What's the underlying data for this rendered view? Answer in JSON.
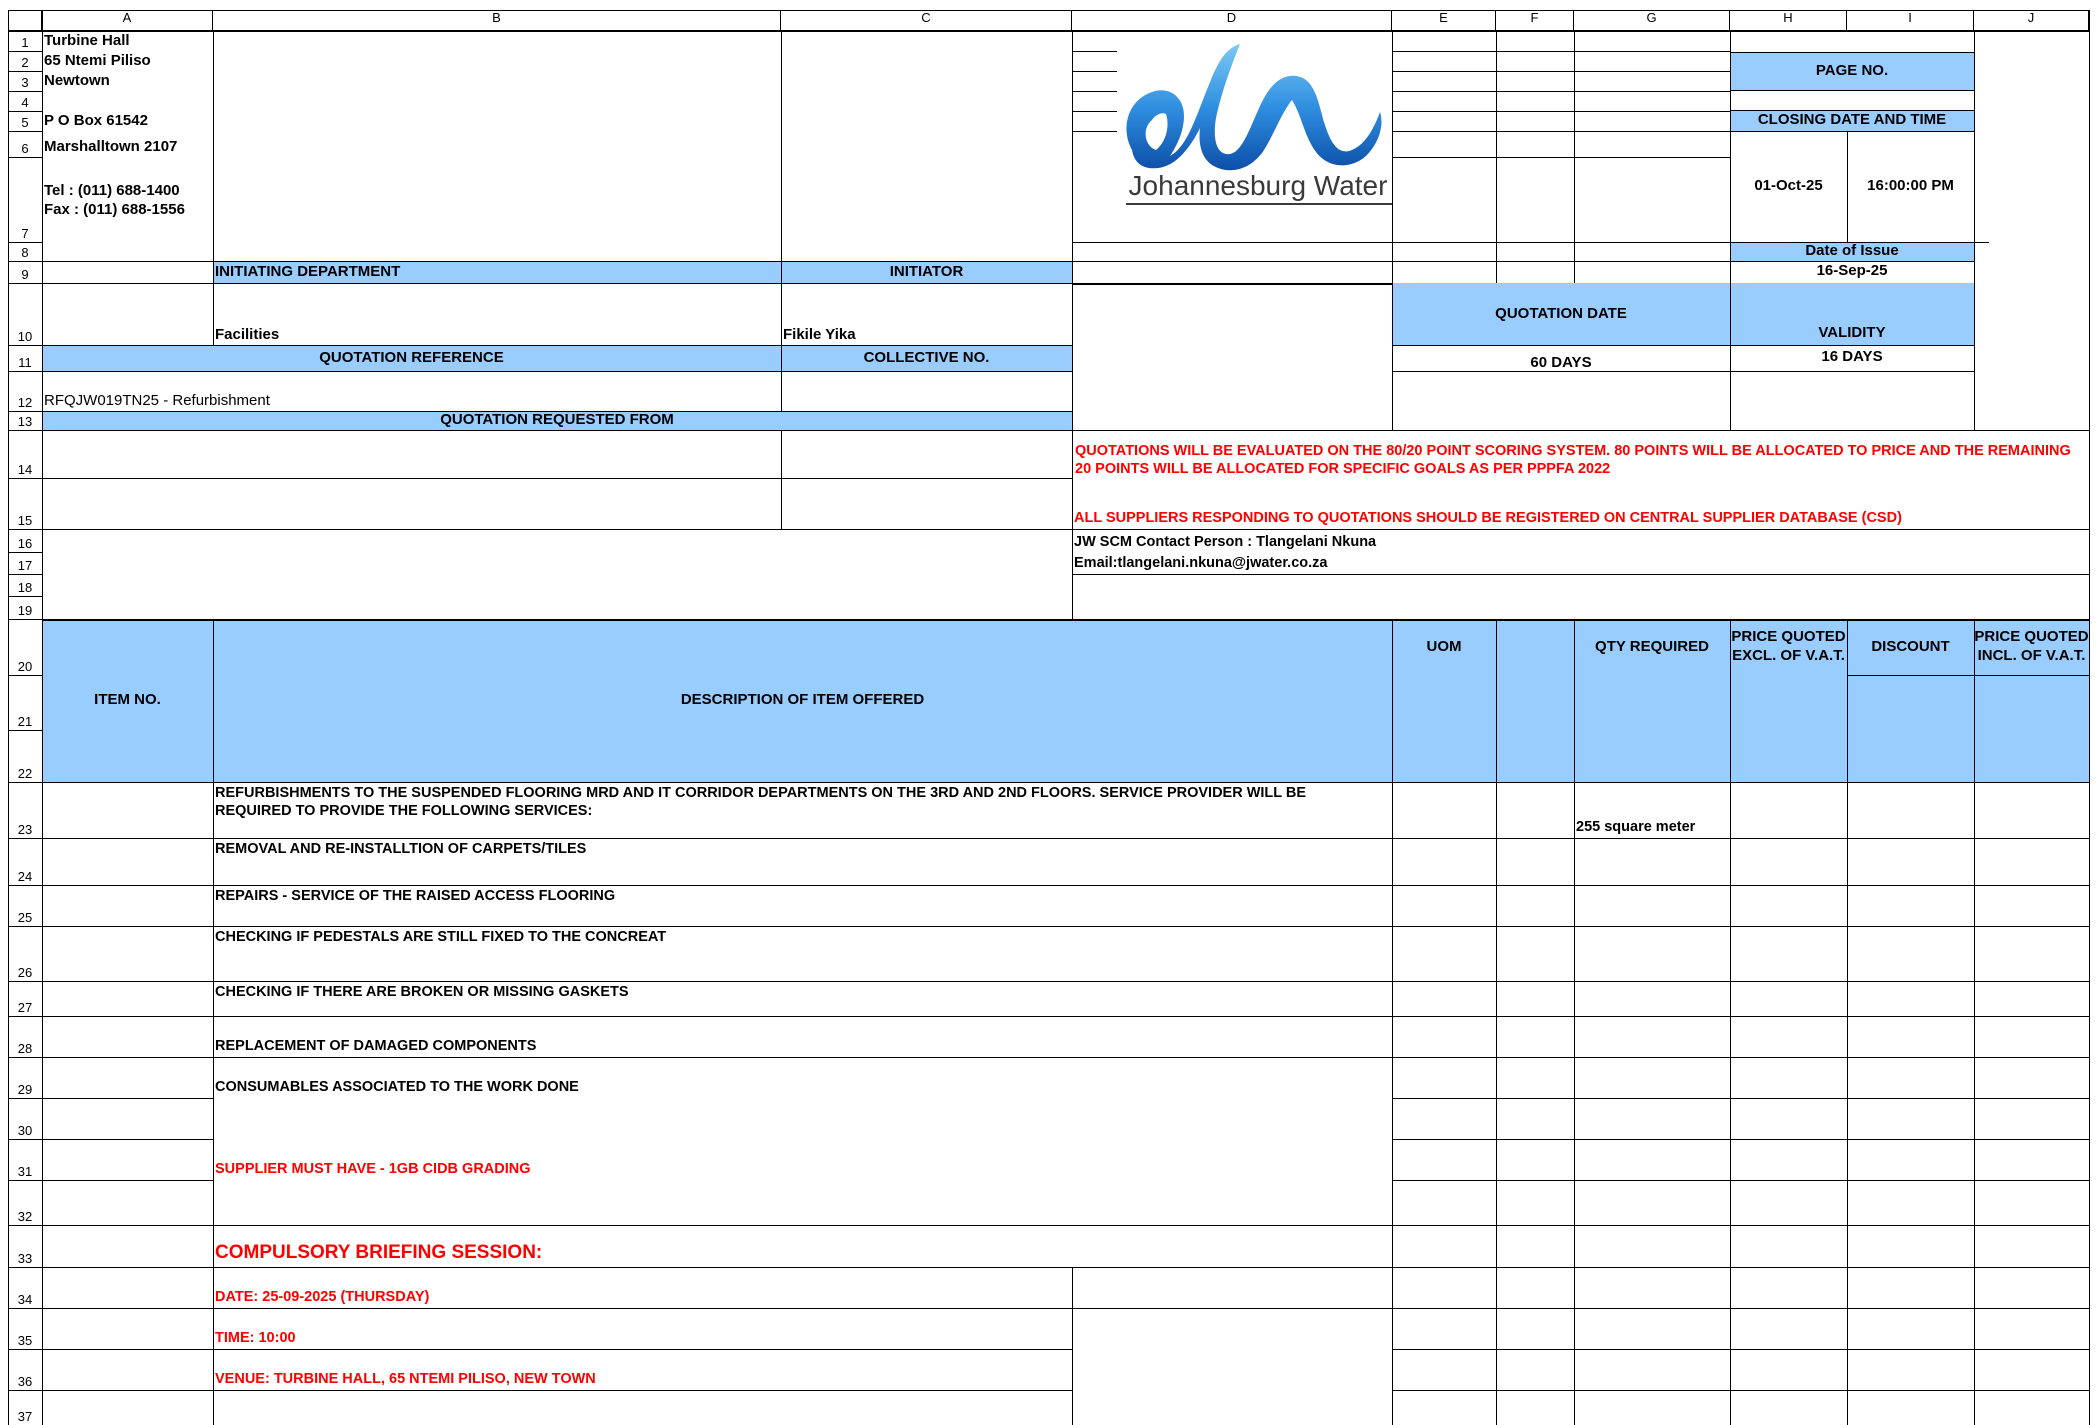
{
  "columns": [
    "A",
    "B",
    "C",
    "D",
    "E",
    "F",
    "G",
    "H",
    "I",
    "J"
  ],
  "rows": [
    "1",
    "2",
    "3",
    "4",
    "5",
    "6",
    "7",
    "8",
    "9",
    "10",
    "11",
    "12",
    "13",
    "14",
    "15",
    "16",
    "17",
    "18",
    "19",
    "20",
    "21",
    "22",
    "23",
    "24",
    "25",
    "26",
    "27",
    "28",
    "29",
    "30",
    "31",
    "32",
    "33",
    "34",
    "35",
    "36",
    "37"
  ],
  "address": {
    "line1": "Turbine Hall",
    "line2": "65 Ntemi Piliso",
    "line3": "Newtown",
    "line5": "P O Box 61542",
    "line6": "Marshalltown 2107",
    "tel": "Tel : (011) 688-1400",
    "fax": "Fax : (011) 688-1556"
  },
  "logo": {
    "text": "Johannesburg Water",
    "color": "#2a6fc0"
  },
  "page_no_label": "PAGE NO.",
  "closing": {
    "label": "CLOSING DATE AND TIME",
    "date": "01-Oct-25",
    "time": "16:00:00 PM"
  },
  "issue": {
    "label": "Date of Issue",
    "date": "16-Sep-25"
  },
  "initiating_department": {
    "label": "INITIATING DEPARTMENT",
    "value": "Facilities"
  },
  "initiator": {
    "label": "INITIATOR",
    "value": "Fikile Yika"
  },
  "quotation_date": {
    "label": "QUOTATION DATE",
    "value": "60 DAYS"
  },
  "validity": {
    "label": "VALIDITY",
    "value": "16 DAYS"
  },
  "quotation_reference": {
    "label": "QUOTATION REFERENCE",
    "value": "RFQJW019TN25 - Refurbishment"
  },
  "collective_no": {
    "label": "COLLECTIVE NO."
  },
  "requested_from_label": "QUOTATION REQUESTED FROM",
  "notices": {
    "scoring": "QUOTATIONS WILL BE EVALUATED ON THE 80/20 POINT SCORING SYSTEM. 80 POINTS WILL BE ALLOCATED TO PRICE AND THE REMAINING 20 POINTS WILL BE ALLOCATED FOR SPECIFIC GOALS AS PER PPPFA 2022",
    "csd": "ALL SUPPLIERS RESPONDING TO QUOTATIONS SHOULD BE REGISTERED ON CENTRAL SUPPLIER DATABASE (CSD)",
    "contact": "JW SCM Contact Person : Tlangelani Nkuna",
    "email": "Email:tlangelani.nkuna@jwater.co.za"
  },
  "table_headers": {
    "item_no": "ITEM NO.",
    "description": "DESCRIPTION OF ITEM OFFERED",
    "uom": "UOM",
    "qty": "QTY REQUIRED",
    "price_excl": "PRICE QUOTED EXCL. OF V.A.T.",
    "discount": "DISCOUNT",
    "price_incl": "PRICE QUOTED INCL. OF V.A.T."
  },
  "items": {
    "r23": "REFURBISHMENTS TO THE SUSPENDED FLOORING MRD AND IT CORRIDOR DEPARTMENTS ON THE 3RD AND 2ND FLOORS.  SERVICE PROVIDER WILL BE REQUIRED TO PROVIDE THE FOLLOWING SERVICES:",
    "r23_qty": "255 square  meter",
    "r24": "REMOVAL AND RE-INSTALLTION OF CARPETS/TILES",
    "r25": "REPAIRS - SERVICE OF THE RAISED ACCESS FLOORING",
    "r26": "CHECKING IF PEDESTALS ARE STILL FIXED TO THE CONCREAT",
    "r27": "CHECKING IF THERE ARE BROKEN OR MISSING GASKETS",
    "r28": "REPLACEMENT OF DAMAGED COMPONENTS",
    "r29": "CONSUMABLES ASSOCIATED TO THE WORK DONE",
    "r31": "SUPPLIER MUST HAVE - 1GB CIDB GRADING",
    "r33": "COMPULSORY BRIEFING SESSION:",
    "r34": "DATE: 25-09-2025 (THURSDAY)",
    "r35": "TIME: 10:00",
    "r36": "VENUE: TURBINE HALL, 65 NTEMI PILISO, NEW TOWN"
  },
  "colors": {
    "header_blue": "#99ccff",
    "notice_red": "#ff0000"
  }
}
